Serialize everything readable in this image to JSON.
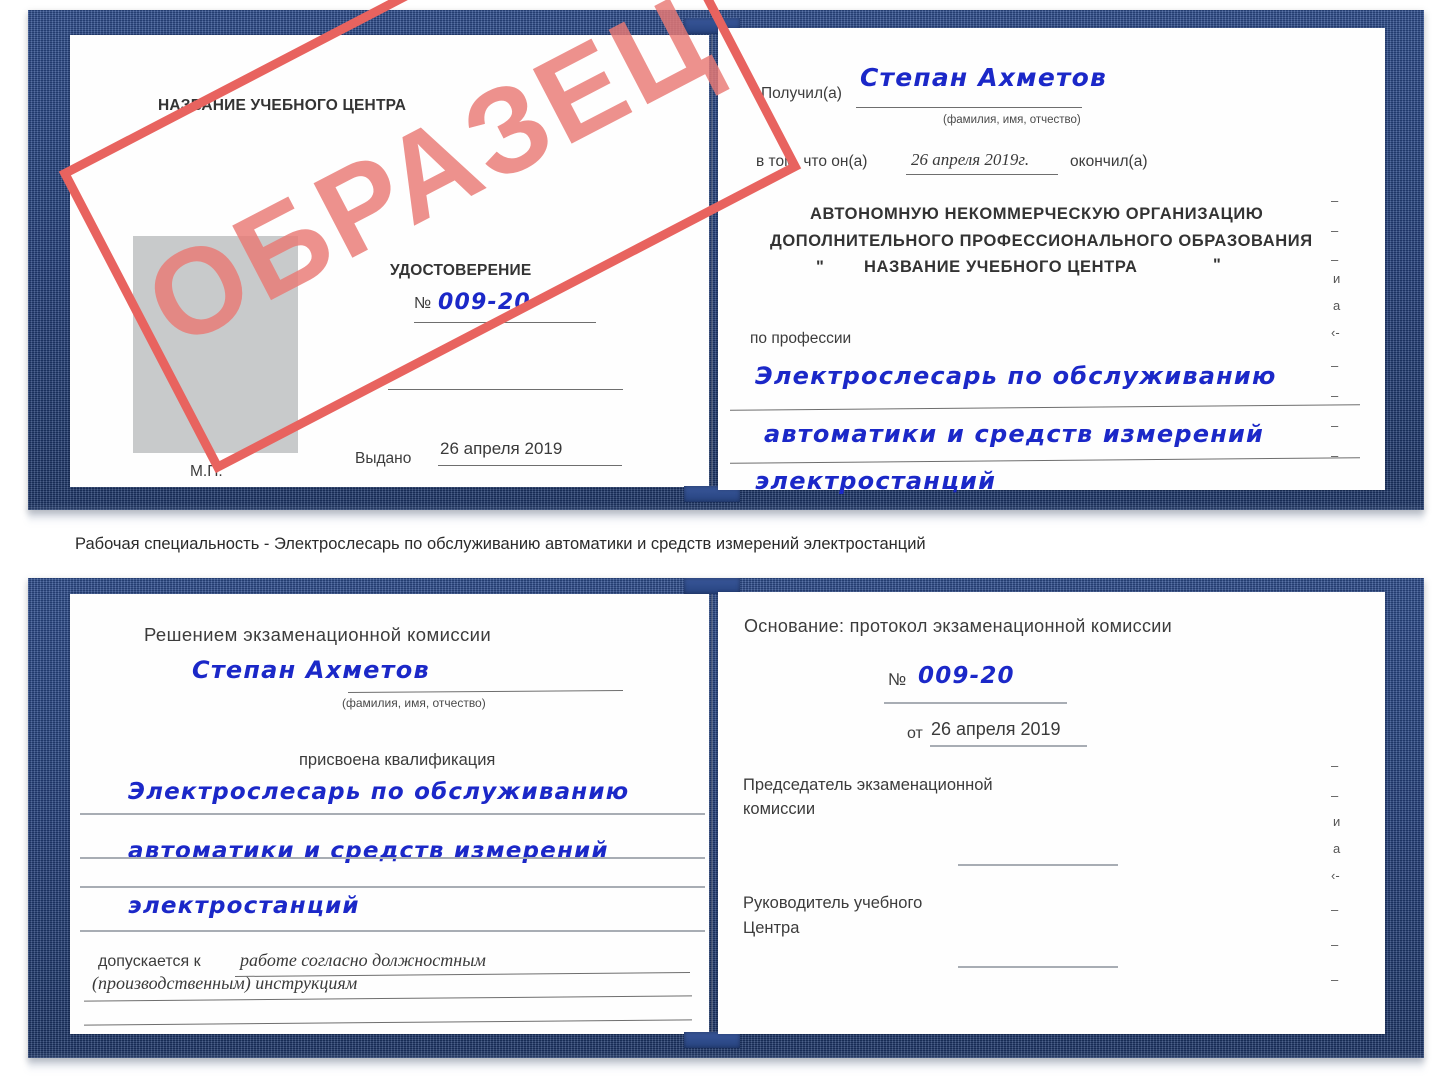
{
  "document": {
    "type": "certificate-scan",
    "title": "Удостоверение — Электрослесарь по обслуживанию автоматики и средств измерений электростанций"
  },
  "stamp": {
    "text": "ОБРАЗЕЦ",
    "color": "#ea7a75"
  },
  "cert_top": {
    "left_page": {
      "center_name": "НАЗВАНИЕ УЧЕБНОГО ЦЕНТРА",
      "doc_word": "УДОСТОВЕРЕНИЕ",
      "number_prefix": "№",
      "number_value": "009-20",
      "issued_label": "Выдано",
      "issued_value": "26 апреля 2019",
      "seal_label": "М.П."
    },
    "right_page": {
      "received_label": "Получил(а)",
      "received_value": "Степан Ахметов",
      "received_hint": "(фамилия, имя, отчество)",
      "that_he_label": "в том, что он(а)",
      "that_he_value": "26 апреля 2019г.",
      "finished_label": "окончил(а)",
      "org_line1": "АВТОНОМНУЮ НЕКОММЕРЧЕСКУЮ ОРГАНИЗАЦИЮ",
      "org_line2": "ДОПОЛНИТЕЛЬНОГО ПРОФЕССИОНАЛЬНОГО ОБРАЗОВАНИЯ",
      "org_quote_open": "\"",
      "org_line3": "НАЗВАНИЕ УЧЕБНОГО ЦЕНТРА",
      "org_quote_close": "\"",
      "profession_label": "по профессии",
      "profession_line1": "Электрослесарь по обслуживанию",
      "profession_line2": "автоматики и средств измерений",
      "profession_line3": "электростанций",
      "margin_scraps": [
        "–",
        "–",
        "–",
        "и",
        "а",
        "‹-",
        "–",
        "–",
        "–",
        "–"
      ]
    }
  },
  "caption": "Рабочая специальность - Электрослесарь по обслуживанию автоматики и средств измерений электростанций",
  "cert_bottom": {
    "left_page": {
      "decision_label": "Решением экзаменационной комиссии",
      "name_value": "Степан Ахметов",
      "name_hint": "(фамилия, имя, отчество)",
      "qualification_label": "присвоена квалификация",
      "qualification_line1": "Электрослесарь по обслуживанию",
      "qualification_line2": "автоматики и средств измерений",
      "qualification_line3": "электростанций",
      "admitted_label": "допускается к",
      "admitted_value1": "работе согласно должностным",
      "admitted_value2": "(производственным) инструкциям"
    },
    "right_page": {
      "basis_label": "Основание: протокол экзаменационной комиссии",
      "number_prefix": "№",
      "number_value": "009-20",
      "date_prefix": "от",
      "date_value": "26 апреля 2019",
      "chair_line1": "Председатель экзаменационной",
      "chair_line2": "комиссии",
      "head_line1": "Руководитель учебного",
      "head_line2": "Центра",
      "margin_scraps": [
        "–",
        "–",
        "и",
        "а",
        "‹-",
        "–",
        "–",
        "–"
      ]
    }
  }
}
